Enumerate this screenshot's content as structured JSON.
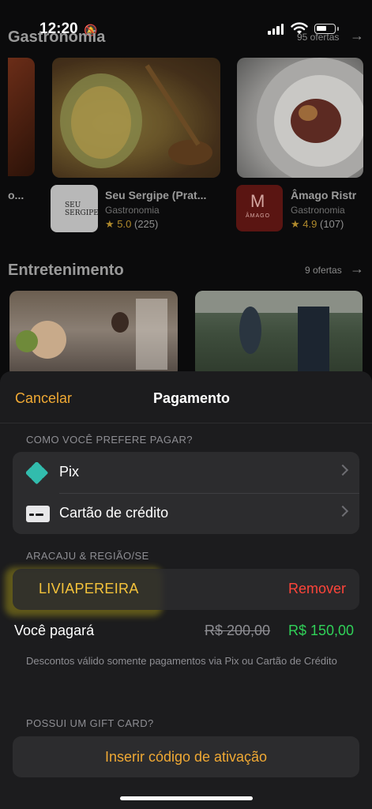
{
  "status_bar": {
    "time": "12:20"
  },
  "background": {
    "sections": [
      {
        "title": "Gastronomia",
        "count": "95 ofertas"
      },
      {
        "title": "Entretenimento",
        "count": "9 ofertas"
      }
    ],
    "cards": [
      {
        "name": "Seu Sergipe (Prat...",
        "category": "Gastronomia",
        "rating": "5.0",
        "reviews": "(225)",
        "logo_text": "SEU SERGIPE"
      },
      {
        "name": "Âmago Ristr",
        "category": "Gastronomia",
        "rating": "4.9",
        "reviews": "(107)",
        "logo_text": "ÂMAGO"
      }
    ],
    "left_card_partial": "o..."
  },
  "sheet": {
    "cancel_label": "Cancelar",
    "title": "Pagamento",
    "payment_caption": "COMO VOCÊ PREFERE PAGAR?",
    "payment_methods": [
      {
        "label": "Pix",
        "icon": "pix-icon"
      },
      {
        "label": "Cartão de crédito",
        "icon": "credit-card-icon"
      }
    ],
    "region_caption": "ARACAJU & REGIÃO/SE",
    "coupon_code": "LIVIAPEREIRA",
    "remove_label": "Remover",
    "you_pay_label": "Você pagará",
    "old_price": "R$ 200,00",
    "new_price": "R$ 150,00",
    "discount_note": "Descontos válido somente pagamentos via Pix ou Cartão de Crédito",
    "gift_caption": "POSSUI UM GIFT CARD?",
    "gift_button_label": "Inserir código de ativação"
  },
  "colors": {
    "accent": "#f0a934",
    "coupon": "#f5c33b",
    "danger": "#ff453a",
    "success": "#30d158",
    "sheet_bg": "#1c1c1e",
    "group_bg": "#2c2c2e"
  }
}
